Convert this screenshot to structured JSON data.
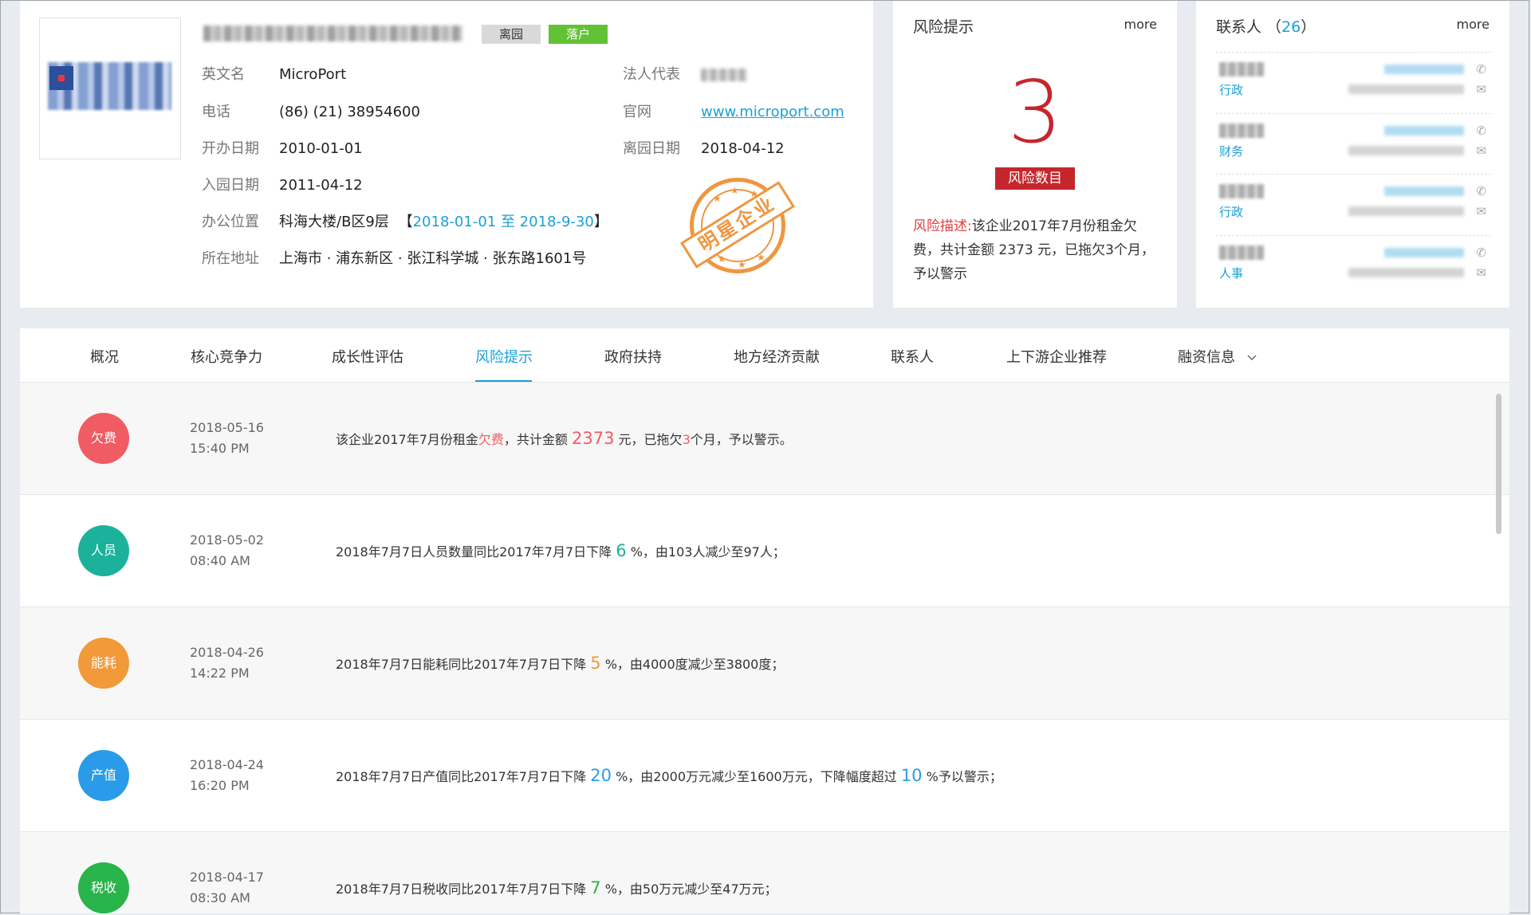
{
  "company": {
    "tags": [
      "离园",
      "落户"
    ],
    "fields": {
      "english_name": {
        "label": "英文名",
        "value": "MicroPort"
      },
      "phone": {
        "label": "电话",
        "value": "(86) (21) 38954600"
      },
      "open_date": {
        "label": "开办日期",
        "value": "2010-01-01"
      },
      "enter_date": {
        "label": "入园日期",
        "value": "2011-04-12"
      },
      "office": {
        "label": "办公位置",
        "value": "科海大楼/B区9层",
        "period_open": "【",
        "period": "2018-01-01 至  2018-9-30",
        "period_close": "】"
      },
      "address": {
        "label": "所在地址",
        "value": "上海市 · 浦东新区 · 张江科学城 · 张东路1601号"
      },
      "legal_rep": {
        "label": "法人代表"
      },
      "website": {
        "label": "官网",
        "value": "www.microport.com"
      },
      "leave_date": {
        "label": "离园日期",
        "value": "2018-04-12"
      }
    },
    "stamp": "明星企业"
  },
  "risk_card": {
    "title": "风险提示",
    "more": "more",
    "count": "3",
    "badge": "风险数目",
    "desc_label": "风险描述:",
    "desc_text": "该企业2017年7月份租金欠费，共计金额 2373 元，已拖欠3个月，予以警示"
  },
  "contacts_card": {
    "title": "联系人",
    "count_open": "（",
    "count": "26",
    "count_close": "）",
    "more": "more",
    "items": [
      {
        "role": "行政"
      },
      {
        "role": "财务"
      },
      {
        "role": "行政"
      },
      {
        "role": "人事"
      }
    ]
  },
  "tabs": [
    "概况",
    "核心竞争力",
    "成长性评估",
    "风险提示",
    "政府扶持",
    "地方经济贡献",
    "联系人",
    "上下游企业推荐",
    "融资信息"
  ],
  "tabs_dropdown_icon": "chevron-down-icon",
  "risk_items": [
    {
      "type": "欠费",
      "color": "#f15b63",
      "date": "2018-05-16",
      "time": "15:40 PM",
      "parts": [
        {
          "t": "该企业2017年7月份租金",
          "c": ""
        },
        {
          "t": "欠费",
          "c": "#f15b63"
        },
        {
          "t": "，共计金额 ",
          "c": ""
        },
        {
          "t": "2373",
          "c": "#f15b63",
          "big": true
        },
        {
          "t": " 元，已拖欠",
          "c": ""
        },
        {
          "t": "3",
          "c": "#f15b63"
        },
        {
          "t": "个月，予以警示。",
          "c": ""
        }
      ]
    },
    {
      "type": "人员",
      "color": "#1bb19b",
      "date": "2018-05-02",
      "time": "08:40 AM",
      "parts": [
        {
          "t": "2018年7月7日人员数量同比2017年7月7日下降 ",
          "c": ""
        },
        {
          "t": "6",
          "c": "#1bb19b",
          "big": true
        },
        {
          "t": " %，由103人减少至97人；",
          "c": ""
        }
      ]
    },
    {
      "type": "能耗",
      "color": "#f2993a",
      "date": "2018-04-26",
      "time": "14:22 PM",
      "parts": [
        {
          "t": "2018年7月7日能耗同比2017年7月7日下降 ",
          "c": ""
        },
        {
          "t": "5",
          "c": "#f2993a",
          "big": true
        },
        {
          "t": " %，由4000度减少至3800度；",
          "c": ""
        }
      ]
    },
    {
      "type": "产值",
      "color": "#2a9be8",
      "date": "2018-04-24",
      "time": "16:20 PM",
      "parts": [
        {
          "t": "2018年7月7日产值同比2017年7月7日下降 ",
          "c": ""
        },
        {
          "t": "20",
          "c": "#2a9be8",
          "big": true
        },
        {
          "t": " %，由2000万元减少至1600万元，下降幅度超过 ",
          "c": ""
        },
        {
          "t": "10",
          "c": "#2a9be8",
          "big": true
        },
        {
          "t": " %予以警示；",
          "c": ""
        }
      ]
    },
    {
      "type": "税收",
      "color": "#28b44a",
      "date": "2018-04-17",
      "time": "08:30 AM",
      "parts": [
        {
          "t": "2018年7月7日税收同比2017年7月7日下降 ",
          "c": ""
        },
        {
          "t": "7",
          "c": "#28b44a",
          "big": true
        },
        {
          "t": " %，由50万元减少至47万元；",
          "c": ""
        }
      ]
    }
  ]
}
